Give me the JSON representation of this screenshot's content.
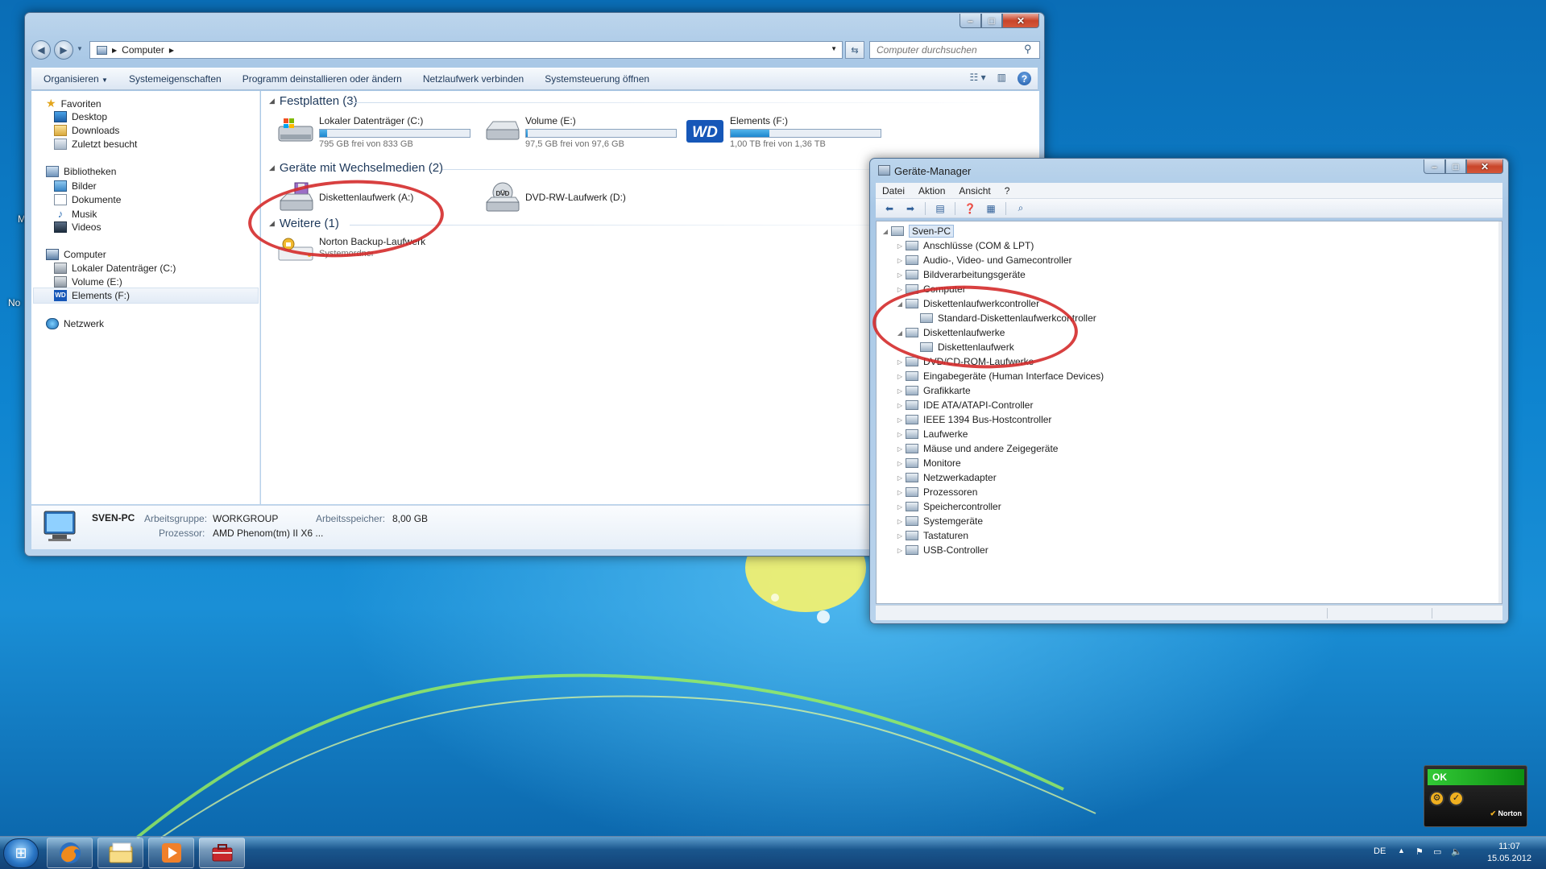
{
  "explorer": {
    "address": {
      "segments": [
        "Computer"
      ]
    },
    "search_placeholder": "Computer durchsuchen",
    "toolbar": [
      "Organisieren",
      "Systemeigenschaften",
      "Programm deinstallieren oder ändern",
      "Netzlaufwerk verbinden",
      "Systemsteuerung öffnen"
    ],
    "nav": {
      "favorites": {
        "label": "Favoriten",
        "items": [
          "Desktop",
          "Downloads",
          "Zuletzt besucht"
        ]
      },
      "libraries": {
        "label": "Bibliotheken",
        "items": [
          "Bilder",
          "Dokumente",
          "Musik",
          "Videos"
        ]
      },
      "computer": {
        "label": "Computer",
        "items": [
          "Lokaler Datenträger (C:)",
          "Volume (E:)",
          "Elements (F:)"
        ]
      },
      "network": {
        "label": "Netzwerk"
      }
    },
    "groups": {
      "hdd": "Festplatten (3)",
      "removable": "Geräte mit Wechselmedien (2)",
      "other": "Weitere (1)"
    },
    "drives": [
      {
        "name": "Lokaler Datenträger (C:)",
        "free": "795 GB frei von 833 GB",
        "used_fraction": 0.05
      },
      {
        "name": "Volume (E:)",
        "free": "97,5 GB frei von 97,6 GB",
        "used_fraction": 0.01
      },
      {
        "name": "Elements (F:)",
        "free": "1,00 TB frei von 1,36 TB",
        "used_fraction": 0.26
      }
    ],
    "removable": [
      {
        "name": "Diskettenlaufwerk (A:)"
      },
      {
        "name": "DVD-RW-Laufwerk (D:)",
        "badge": "DVD"
      }
    ],
    "wd_logo": "WD",
    "other": {
      "name": "Norton Backup-Laufwerk",
      "sub": "Systemordner"
    },
    "details": {
      "pc": "SVEN-PC",
      "workgroup_label": "Arbeitsgruppe:",
      "workgroup": "WORKGROUP",
      "ram_label": "Arbeitsspeicher:",
      "ram": "8,00 GB",
      "cpu_label": "Prozessor:",
      "cpu": "AMD Phenom(tm) II X6 ..."
    }
  },
  "devmgr": {
    "title": "Geräte-Manager",
    "menu": [
      "Datei",
      "Aktion",
      "Ansicht",
      "?"
    ],
    "tree": [
      {
        "label": "Sven-PC",
        "level": 0,
        "state": "open",
        "root": true
      },
      {
        "label": "Anschlüsse (COM & LPT)",
        "level": 1,
        "state": "closed"
      },
      {
        "label": "Audio-, Video- und Gamecontroller",
        "level": 1,
        "state": "closed"
      },
      {
        "label": "Bildverarbeitungsgeräte",
        "level": 1,
        "state": "closed"
      },
      {
        "label": "Computer",
        "level": 1,
        "state": "closed"
      },
      {
        "label": "Diskettenlaufwerkcontroller",
        "level": 1,
        "state": "open"
      },
      {
        "label": "Standard-Diskettenlaufwerkcontroller",
        "level": 2,
        "state": "leaf"
      },
      {
        "label": "Diskettenlaufwerke",
        "level": 1,
        "state": "open"
      },
      {
        "label": "Diskettenlaufwerk",
        "level": 2,
        "state": "leaf"
      },
      {
        "label": "DVD/CD-ROM-Laufwerke",
        "level": 1,
        "state": "closed"
      },
      {
        "label": "Eingabegeräte (Human Interface Devices)",
        "level": 1,
        "state": "closed"
      },
      {
        "label": "Grafikkarte",
        "level": 1,
        "state": "closed"
      },
      {
        "label": "IDE ATA/ATAPI-Controller",
        "level": 1,
        "state": "closed"
      },
      {
        "label": "IEEE 1394 Bus-Hostcontroller",
        "level": 1,
        "state": "closed"
      },
      {
        "label": "Laufwerke",
        "level": 1,
        "state": "closed"
      },
      {
        "label": "Mäuse und andere Zeigegeräte",
        "level": 1,
        "state": "closed"
      },
      {
        "label": "Monitore",
        "level": 1,
        "state": "closed"
      },
      {
        "label": "Netzwerkadapter",
        "level": 1,
        "state": "closed"
      },
      {
        "label": "Prozessoren",
        "level": 1,
        "state": "closed"
      },
      {
        "label": "Speichercontroller",
        "level": 1,
        "state": "closed"
      },
      {
        "label": "Systemgeräte",
        "level": 1,
        "state": "closed"
      },
      {
        "label": "Tastaturen",
        "level": 1,
        "state": "closed"
      },
      {
        "label": "USB-Controller",
        "level": 1,
        "state": "closed"
      }
    ]
  },
  "desktop": {
    "partial_icons": [
      "M",
      "No"
    ]
  },
  "norton_widget": {
    "status": "OK",
    "brand": "Norton"
  },
  "taskbar": {
    "lang": "DE",
    "time": "11:07",
    "date": "15.05.2012"
  },
  "colors": {
    "annotation": "#d42b2b",
    "selection": "#dce8f6",
    "accent": "#1e395b"
  }
}
